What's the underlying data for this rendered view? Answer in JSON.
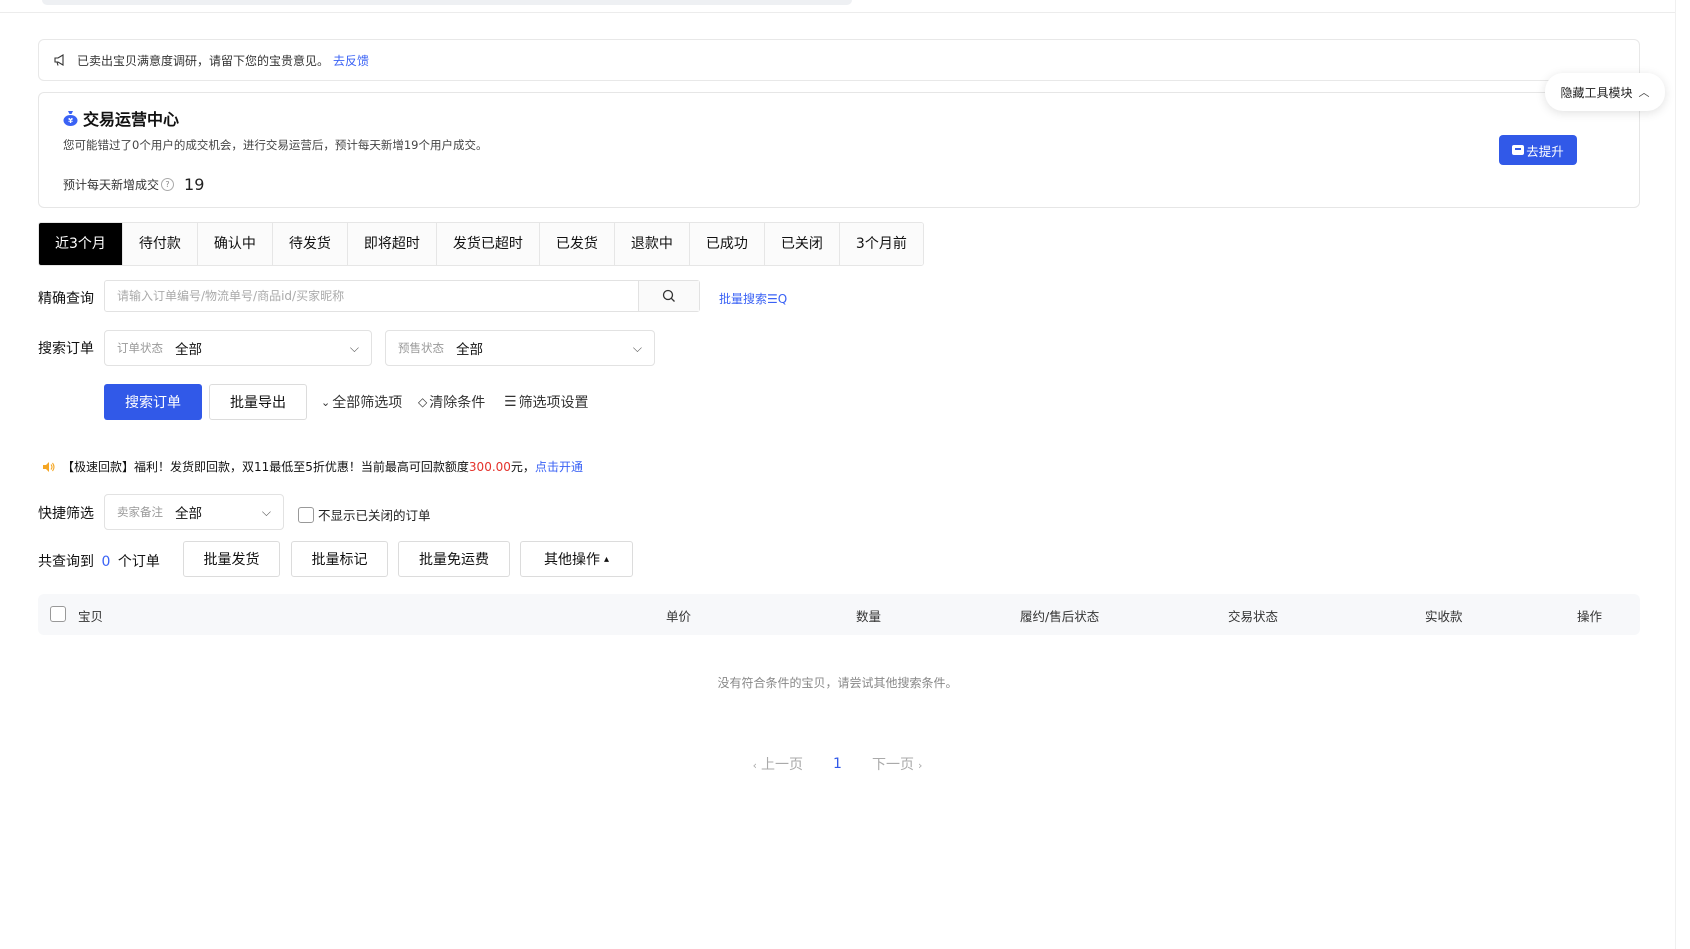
{
  "notice": {
    "text": "已卖出宝贝满意度调研，请留下您的宝贵意见。",
    "link": "去反馈"
  },
  "hide_tool": {
    "label": "隐藏工具模块"
  },
  "trade_center": {
    "title": "交易运营中心",
    "description": "您可能错过了0个用户的成交机会，进行交易运营后，预计每天新增19个用户成交。",
    "estimate_label": "预计每天新增成交",
    "estimate_value": "19",
    "button": "去提升"
  },
  "tabs": [
    "近3个月",
    "待付款",
    "确认中",
    "待发货",
    "即将超时",
    "发货已超时",
    "已发货",
    "退款中",
    "已成功",
    "已关闭",
    "3个月前"
  ],
  "active_tab": "近3个月",
  "exact_query": {
    "label": "精确查询",
    "placeholder": "请输入订单编号/物流单号/商品id/买家昵称",
    "batch_search": "批量搜索"
  },
  "search_orders": {
    "label": "搜索订单",
    "order_status": {
      "key": "订单状态",
      "value": "全部"
    },
    "presale_status": {
      "key": "预售状态",
      "value": "全部"
    }
  },
  "actions": {
    "search_button": "搜索订单",
    "export_button": "批量导出",
    "all_filters": "全部筛选项",
    "clear": "清除条件",
    "filter_settings": "筛选项设置"
  },
  "promo": {
    "prefix": "【极速回款】福利！发货即回款，双11最低至5折优惠！当前最高可回款额度",
    "amount": "300.00",
    "suffix": "元，",
    "link": "点击开通"
  },
  "quick_filter": {
    "label": "快捷筛选",
    "seller_note": {
      "key": "卖家备注",
      "value": "全部"
    },
    "hide_closed": "不显示已关闭的订单"
  },
  "result": {
    "prefix": "共查询到",
    "count": "0",
    "suffix": "个订单"
  },
  "batch_buttons": {
    "ship": "批量发货",
    "mark": "批量标记",
    "free_shipping": "批量免运费",
    "other": "其他操作"
  },
  "table_headers": {
    "item": "宝贝",
    "price": "单价",
    "quantity": "数量",
    "fulfillment": "履约/售后状态",
    "trade_status": "交易状态",
    "received": "实收款",
    "operation": "操作"
  },
  "empty_message": "没有符合条件的宝贝，请尝试其他搜索条件。",
  "pagination": {
    "prev": "上一页",
    "current": "1",
    "next": "下一页"
  },
  "colors": {
    "primary": "#3159e8",
    "link": "#3a62f5",
    "price_red": "#e4322b"
  }
}
